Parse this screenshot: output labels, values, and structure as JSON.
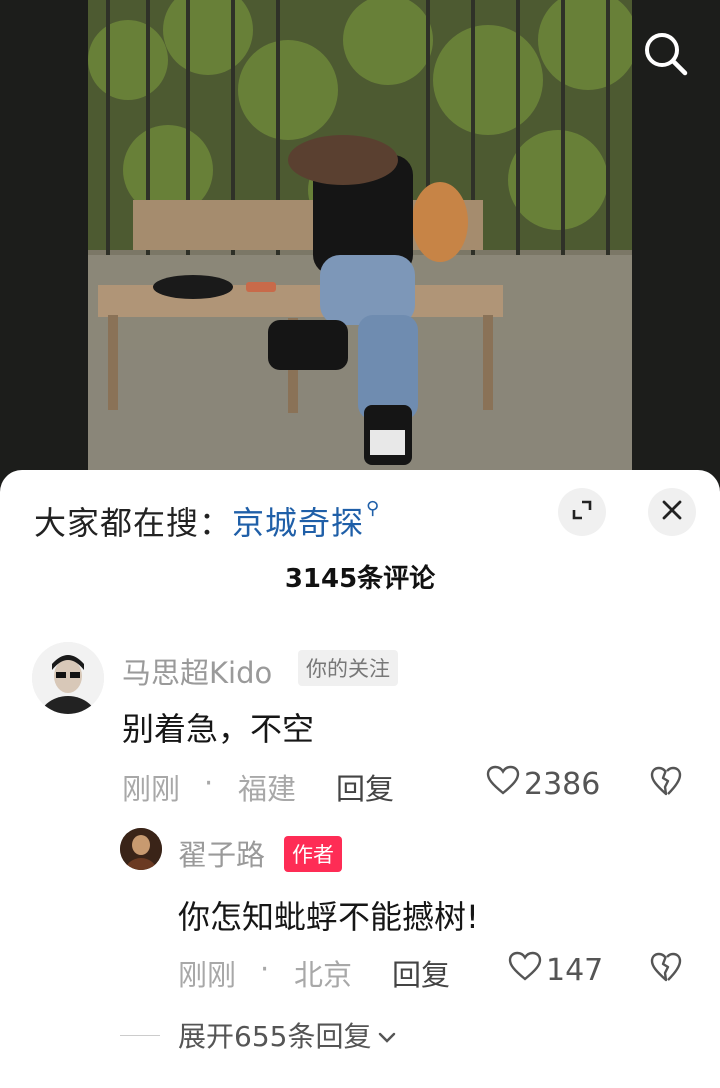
{
  "search_icon": "search-icon",
  "hot_search": {
    "prefix": "大家都在搜：",
    "keyword": "京城奇探"
  },
  "comments_title": "3145条评论",
  "comment": {
    "author": "马思超Kido",
    "badge": "你的关注",
    "text": "别着急，不空",
    "time": "刚刚",
    "location": "福建",
    "reply_label": "回复",
    "likes": "2386"
  },
  "sub_comment": {
    "author": "翟子路",
    "badge": "作者",
    "text": "你怎知蚍蜉不能撼树!",
    "time": "刚刚",
    "location": "北京",
    "reply_label": "回复",
    "likes": "147"
  },
  "expand_label": "展开655条回复",
  "colors": {
    "keyword": "#1f5fa8",
    "author_badge": "#fe2c55"
  }
}
